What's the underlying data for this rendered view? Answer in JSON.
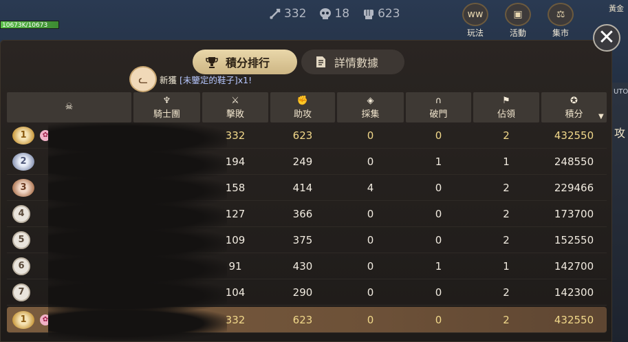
{
  "hud": {
    "hp_text": "10673K/10673",
    "stats": [
      {
        "icon": "sword-icon",
        "value": "332"
      },
      {
        "icon": "skull-icon",
        "value": "18"
      },
      {
        "icon": "fist-icon",
        "value": "623"
      }
    ],
    "top_buttons": [
      {
        "label": "玩法",
        "icon": "gameplay-icon"
      },
      {
        "label": "活動",
        "icon": "gift-icon"
      },
      {
        "label": "集市",
        "icon": "scale-icon"
      }
    ],
    "gold_label": "黃金",
    "side_labels": [
      "UTO",
      "攻"
    ]
  },
  "tabs": [
    {
      "label": "積分排行",
      "icon": "trophy-icon",
      "active": true
    },
    {
      "label": "詳情數據",
      "icon": "document-icon",
      "active": false
    }
  ],
  "notice": {
    "prefix": "新獲",
    "item": "[未鑒定的鞋子]x1!"
  },
  "table": {
    "headers": [
      {
        "key": "name",
        "label": "",
        "icon": "skull-icon"
      },
      {
        "key": "knight",
        "label": "騎士團",
        "icon": "knight-crest-icon"
      },
      {
        "key": "kill",
        "label": "擊敗",
        "icon": "sword-icon"
      },
      {
        "key": "assist",
        "label": "助攻",
        "icon": "fist-icon"
      },
      {
        "key": "gather",
        "label": "採集",
        "icon": "crystal-icon"
      },
      {
        "key": "break",
        "label": "破門",
        "icon": "gate-icon"
      },
      {
        "key": "occupy",
        "label": "佔領",
        "icon": "flag-icon"
      },
      {
        "key": "score",
        "label": "積分",
        "icon": "star-icon"
      }
    ],
    "sort_indicator": "▼",
    "rows": [
      {
        "rank": "1",
        "medal": "gold",
        "badge": true,
        "kill": "332",
        "assist": "623",
        "gather": "0",
        "break": "0",
        "occupy": "2",
        "score": "432550"
      },
      {
        "rank": "2",
        "medal": "silver",
        "badge": false,
        "kill": "194",
        "assist": "249",
        "gather": "0",
        "break": "1",
        "occupy": "1",
        "score": "248550"
      },
      {
        "rank": "3",
        "medal": "bronze",
        "badge": false,
        "kill": "158",
        "assist": "414",
        "gather": "4",
        "break": "0",
        "occupy": "2",
        "score": "229466"
      },
      {
        "rank": "4",
        "medal": "plain",
        "badge": false,
        "kill": "127",
        "assist": "366",
        "gather": "0",
        "break": "0",
        "occupy": "2",
        "score": "173700"
      },
      {
        "rank": "5",
        "medal": "plain",
        "badge": false,
        "kill": "109",
        "assist": "375",
        "gather": "0",
        "break": "0",
        "occupy": "2",
        "score": "152550"
      },
      {
        "rank": "6",
        "medal": "plain",
        "badge": false,
        "kill": "91",
        "assist": "430",
        "gather": "0",
        "break": "1",
        "occupy": "1",
        "score": "142700"
      },
      {
        "rank": "7",
        "medal": "plain",
        "badge": false,
        "kill": "104",
        "assist": "290",
        "gather": "0",
        "break": "0",
        "occupy": "2",
        "score": "142300"
      }
    ],
    "self_row": {
      "rank": "1",
      "medal": "gold",
      "badge": true,
      "kill": "332",
      "assist": "623",
      "gather": "0",
      "break": "0",
      "occupy": "2",
      "score": "432550"
    }
  },
  "colors": {
    "accent": "#cdb684",
    "panel": "#1e1b19",
    "highlight_row": "#6d5138",
    "top_rank_text": "#f1d88a"
  }
}
